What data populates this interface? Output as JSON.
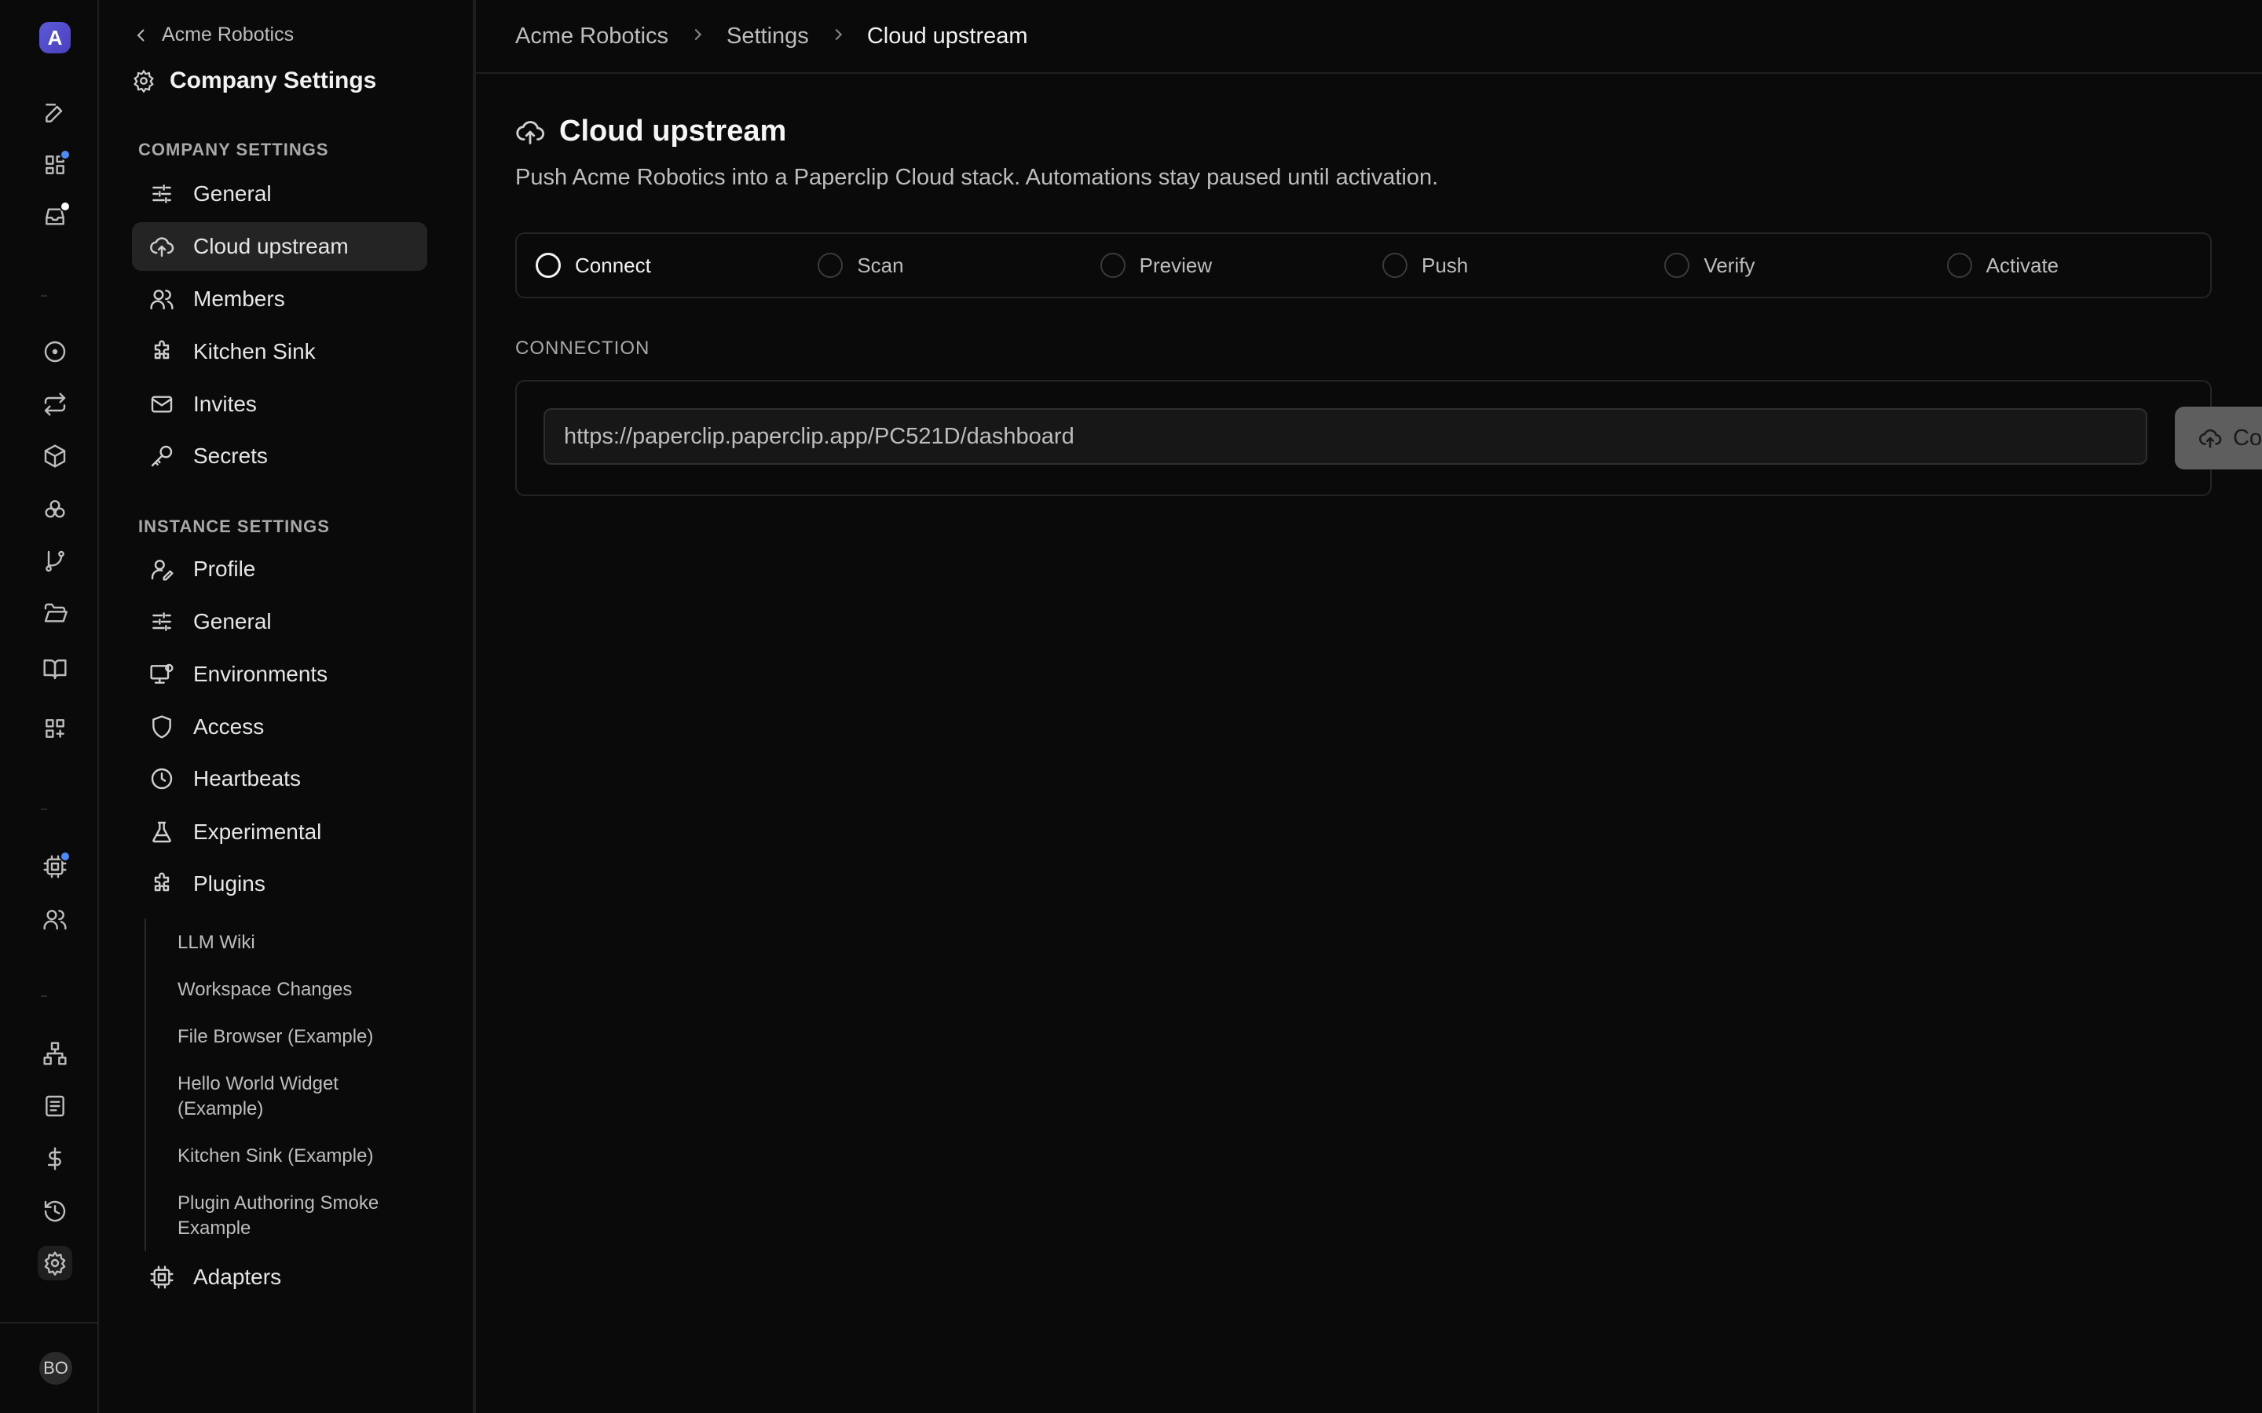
{
  "rail": {
    "logo_letter": "A",
    "avatar_initials": "BO",
    "accent_blue": "#4d8cf5",
    "icons": [
      {
        "name": "new-issue-icon"
      },
      {
        "name": "dashboard-icon",
        "dot": "#4d8cf5"
      },
      {
        "name": "inbox-icon",
        "dot": "#ffffff"
      },
      {
        "name": "issues-icon"
      },
      {
        "name": "routines-icon"
      },
      {
        "name": "packages-icon"
      },
      {
        "name": "goals-icon"
      },
      {
        "name": "branches-icon"
      },
      {
        "name": "files-icon"
      },
      {
        "name": "docs-icon"
      },
      {
        "name": "apps-icon"
      },
      {
        "name": "agents-chip-icon",
        "dot": "#4d8cf5"
      },
      {
        "name": "team-icon"
      },
      {
        "name": "org-chart-icon"
      },
      {
        "name": "logs-icon"
      },
      {
        "name": "costs-icon"
      },
      {
        "name": "history-icon"
      },
      {
        "name": "settings-icon",
        "active": true
      }
    ]
  },
  "sidebar": {
    "back_label": "Acme Robotics",
    "title": "Company Settings",
    "company_section_label": "COMPANY SETTINGS",
    "company_items": [
      {
        "label": "General",
        "icon": "sliders-icon"
      },
      {
        "label": "Cloud upstream",
        "icon": "cloud-upload-icon",
        "active": true
      },
      {
        "label": "Members",
        "icon": "users-icon"
      },
      {
        "label": "Kitchen Sink",
        "icon": "puzzle-icon"
      },
      {
        "label": "Invites",
        "icon": "mail-icon"
      },
      {
        "label": "Secrets",
        "icon": "key-icon"
      }
    ],
    "instance_section_label": "INSTANCE SETTINGS",
    "instance_items": [
      {
        "label": "Profile",
        "icon": "user-pen-icon"
      },
      {
        "label": "General",
        "icon": "sliders-icon"
      },
      {
        "label": "Environments",
        "icon": "monitor-icon"
      },
      {
        "label": "Access",
        "icon": "shield-icon"
      },
      {
        "label": "Heartbeats",
        "icon": "clock-icon"
      },
      {
        "label": "Experimental",
        "icon": "flask-icon"
      },
      {
        "label": "Plugins",
        "icon": "puzzle-icon"
      }
    ],
    "plugin_items": [
      "LLM Wiki",
      "Workspace Changes",
      "File Browser (Example)",
      "Hello World Widget (Example)",
      "Kitchen Sink (Example)",
      "Plugin Authoring Smoke Example"
    ],
    "adapters_label": "Adapters"
  },
  "breadcrumb": [
    "Acme Robotics",
    "Settings",
    "Cloud upstream"
  ],
  "page": {
    "title": "Cloud upstream",
    "description": "Push Acme Robotics into a Paperclip Cloud stack. Automations stay paused until activation.",
    "steps": [
      "Connect",
      "Scan",
      "Preview",
      "Push",
      "Verify",
      "Activate"
    ],
    "active_step": "Connect",
    "connection_label": "CONNECTION",
    "url_value": "https://paperclip.paperclip.app/PC521D/dashboard",
    "connect_button_label": "Connect"
  }
}
